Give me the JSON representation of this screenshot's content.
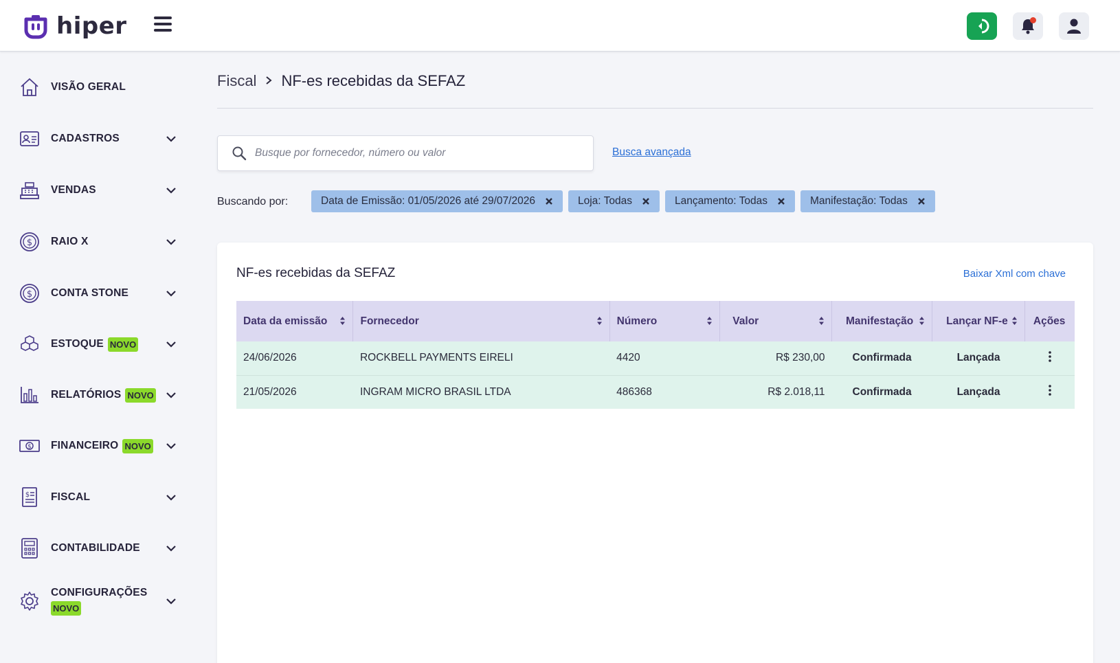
{
  "app": {
    "logo_text": "hiper"
  },
  "sidebar": {
    "items": [
      {
        "label": "VISÃO GERAL",
        "icon": "home-icon"
      },
      {
        "label": "CADASTROS",
        "icon": "id-card-icon"
      },
      {
        "label": "VENDAS",
        "icon": "cash-register-icon"
      },
      {
        "label": "RAIO X",
        "icon": "money-cycle-icon"
      },
      {
        "label": "CONTA STONE",
        "icon": "dollar-cycle-icon"
      },
      {
        "label": "ESTOQUE",
        "icon": "boxes-icon",
        "badge": "NOVO"
      },
      {
        "label": "RELATÓRIOS",
        "icon": "bar-chart-icon",
        "badge": "NOVO"
      },
      {
        "label": "FINANCEIRO",
        "icon": "banknote-icon",
        "badge": "NOVO"
      },
      {
        "label": "FISCAL",
        "icon": "receipt-icon"
      },
      {
        "label": "CONTABILIDADE",
        "icon": "calculator-icon"
      },
      {
        "label": "CONFIGURAÇÕES",
        "icon": "gear-icon",
        "badge": "NOVO"
      }
    ]
  },
  "breadcrumb": {
    "parent": "Fiscal",
    "current": "NF-es recebidas da SEFAZ"
  },
  "search": {
    "placeholder": "Busque por fornecedor, número ou valor",
    "value": "",
    "advanced_link": "Busca avançada"
  },
  "filters": {
    "label": "Buscando por:",
    "chips": [
      "Data de Emissão: 01/05/2026 até 29/07/2026",
      "Loja: Todas",
      "Lançamento: Todas",
      "Manifestação: Todas"
    ]
  },
  "card": {
    "title": "NF-es recebidas da SEFAZ",
    "link": "Baixar Xml com chave",
    "columns": [
      "Data da emissão",
      "Fornecedor",
      "Número",
      "Valor",
      "Manifestação",
      "Lançar NF-e",
      "Ações"
    ],
    "rows": [
      {
        "data": "24/06/2026",
        "fornecedor": "ROCKBELL PAYMENTS EIRELI",
        "numero": "4420",
        "valor": "R$ 230,00",
        "manifestacao": "Confirmada",
        "lancamento": "Lançada"
      },
      {
        "data": "21/05/2026",
        "fornecedor": "INGRAM MICRO BRASIL LTDA",
        "numero": "486368",
        "valor": "R$ 2.018,11",
        "manifestacao": "Confirmada",
        "lancamento": "Lançada"
      }
    ]
  },
  "colors": {
    "accent": "#2b6fd6",
    "success": "#1e9c52",
    "badge": "#8bd92b",
    "header_bg": "#dcd9f1",
    "row_bg": "#dff3ec",
    "chip_bg": "#9ebfe9",
    "stone_green": "#17a354"
  }
}
